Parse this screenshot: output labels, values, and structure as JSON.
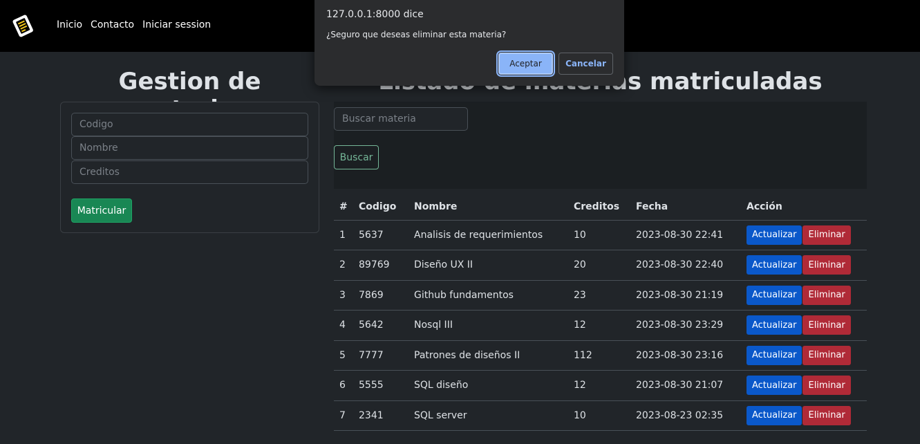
{
  "nav": {
    "links": [
      "Inicio",
      "Contacto",
      "Iniciar session"
    ]
  },
  "left": {
    "title": "Gestion de materias",
    "fields": {
      "codigo_placeholder": "Codigo",
      "nombre_placeholder": "Nombre",
      "creditos_placeholder": "Creditos"
    },
    "submit_label": "Matricular"
  },
  "right": {
    "title": "Listado de materias matriculadas",
    "search_placeholder": "Buscar materia",
    "search_button": "Buscar",
    "table": {
      "headers": [
        "#",
        "Codigo",
        "Nombre",
        "Creditos",
        "Fecha",
        "Acción"
      ],
      "rows": [
        [
          "1",
          "5637",
          "Analisis de requerimientos",
          "10",
          "2023-08-30 22:41"
        ],
        [
          "2",
          "89769",
          "Diseño UX II",
          "20",
          "2023-08-30 22:40"
        ],
        [
          "3",
          "7869",
          "Github fundamentos",
          "23",
          "2023-08-30 21:19"
        ],
        [
          "4",
          "5642",
          "Nosql III",
          "12",
          "2023-08-30 23:29"
        ],
        [
          "5",
          "7777",
          "Patrones de diseños II",
          "112",
          "2023-08-30 23:16"
        ],
        [
          "6",
          "5555",
          "SQL diseño",
          "12",
          "2023-08-30 21:07"
        ],
        [
          "7",
          "2341",
          "SQL server",
          "10",
          "2023-08-23 02:35"
        ]
      ],
      "update_label": "Actualizar",
      "delete_label": "Eliminar"
    }
  },
  "dialog": {
    "title": "127.0.0.1:8000 dice",
    "message": "¿Seguro que deseas eliminar esta materia?",
    "ok_label": "Aceptar",
    "cancel_label": "Cancelar"
  },
  "colors": {
    "background": "#212529",
    "navbar": "#000000",
    "success": "#198754",
    "primary": "#0a58ca",
    "danger": "#b02a37",
    "dialog_accent": "#8ab4f8"
  }
}
